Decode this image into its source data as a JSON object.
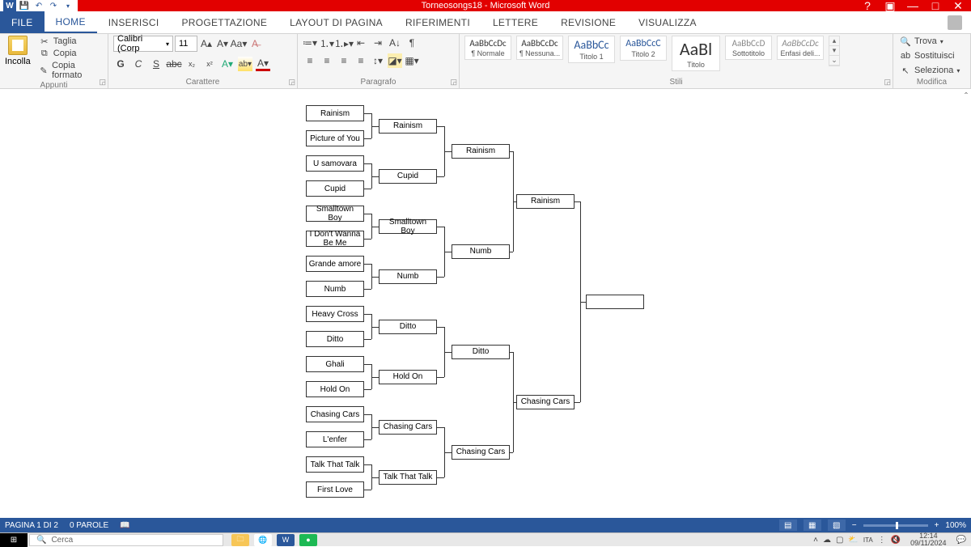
{
  "app_title": "Torneosongs18 - Microsoft Word",
  "tabs": {
    "file": "FILE",
    "home": "HOME",
    "inserisci": "INSERISCI",
    "progettazione": "PROGETTAZIONE",
    "layout": "LAYOUT DI PAGINA",
    "riferimenti": "RIFERIMENTI",
    "lettere": "LETTERE",
    "revisione": "REVISIONE",
    "visualizza": "VISUALIZZA"
  },
  "clipboard": {
    "paste": "Incolla",
    "cut": "Taglia",
    "copy": "Copia",
    "format": "Copia formato",
    "group": "Appunti"
  },
  "font": {
    "name": "Calibri (Corp",
    "size": "11",
    "group": "Carattere"
  },
  "paragraph": {
    "group": "Paragrafo"
  },
  "styles": {
    "items": [
      {
        "sample": "AaBbCcDc",
        "name": "¶ Normale"
      },
      {
        "sample": "AaBbCcDc",
        "name": "¶ Nessuna..."
      },
      {
        "sample": "AaBbCc",
        "name": "Titolo 1"
      },
      {
        "sample": "AaBbCcC",
        "name": "Titolo 2"
      },
      {
        "sample": "AaBl",
        "name": "Titolo"
      },
      {
        "sample": "AaBbCcD",
        "name": "Sottotitolo"
      },
      {
        "sample": "AaBbCcDc",
        "name": "Enfasi deli..."
      }
    ],
    "group": "Stili"
  },
  "editing": {
    "find": "Trova",
    "replace": "Sostituisci",
    "select": "Seleziona",
    "group": "Modifica"
  },
  "bracket": {
    "r1": [
      "Rainism",
      "Picture of You",
      "U samovara",
      "Cupid",
      "Smalltown Boy",
      "I Don't Wanna Be Me",
      "Grande amore",
      "Numb",
      "Heavy Cross",
      "Ditto",
      "Ghali",
      "Hold On",
      "Chasing Cars",
      "L'enfer",
      "Talk That Talk",
      "First Love"
    ],
    "r2": [
      "Rainism",
      "Cupid",
      "Smalltown Boy",
      "Numb",
      "Ditto",
      "Hold On",
      "Chasing Cars",
      "Talk That Talk"
    ],
    "r3": [
      "Rainism",
      "Numb",
      "Ditto",
      "Chasing Cars"
    ],
    "r4": [
      "Rainism",
      "Chasing Cars"
    ],
    "r5": [
      ""
    ]
  },
  "statusbar": {
    "page": "PAGINA 1 DI 2",
    "words": "0 PAROLE",
    "zoom": "100%"
  },
  "taskbar": {
    "search": "Cerca",
    "time": "12:14",
    "date": "09/11/2024"
  }
}
